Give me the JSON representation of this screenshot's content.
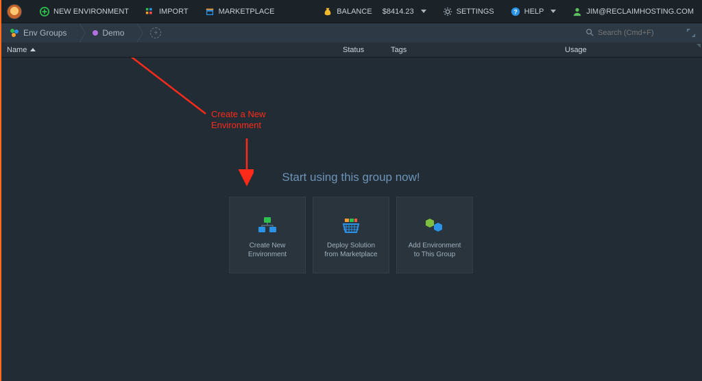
{
  "topbar": {
    "new_env": "NEW ENVIRONMENT",
    "import": "IMPORT",
    "marketplace": "MARKETPLACE",
    "balance_label": "BALANCE",
    "balance_value": "$8414.23",
    "settings": "SETTINGS",
    "help": "HELP",
    "user": "JIM@RECLAIMHOSTING.COM"
  },
  "breadcrumb": {
    "root": "Env Groups",
    "current": "Demo",
    "search_placeholder": "Search (Cmd+F)"
  },
  "table": {
    "name": "Name",
    "status": "Status",
    "tags": "Tags",
    "usage": "Usage"
  },
  "annotation": {
    "line1": "Create a New",
    "line2": "Environment"
  },
  "empty": {
    "title": "Start using this group now!",
    "cards": [
      {
        "line1": "Create New",
        "line2": "Environment"
      },
      {
        "line1": "Deploy Solution",
        "line2": "from Marketplace"
      },
      {
        "line1": "Add Environment",
        "line2": "to This Group"
      }
    ]
  }
}
